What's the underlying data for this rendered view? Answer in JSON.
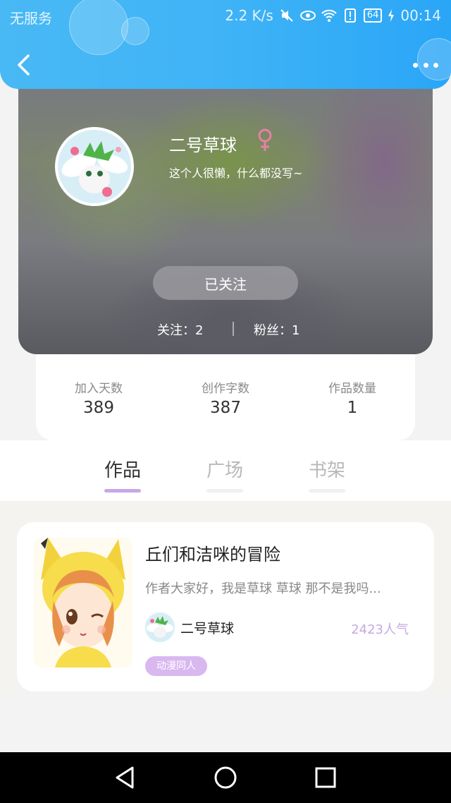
{
  "status_bar": {
    "carrier": "无服务",
    "net_speed": "2.2 K/s",
    "battery": "64",
    "time": "00:14",
    "icons": [
      "mute-icon",
      "eye-icon",
      "wifi-icon",
      "alert-icon",
      "battery-icon",
      "charging-icon"
    ]
  },
  "header": {
    "back_icon": "chevron-left-icon",
    "more_icon": "more-dots-icon"
  },
  "profile": {
    "nickname": "二号草球",
    "gender_symbol": "♀",
    "gender": "female",
    "bio": "这个人很懒，什么都没写~",
    "follow_button": "已关注",
    "following": "关注：2",
    "fans": "粉丝：1"
  },
  "stats": [
    {
      "label": "加入天数",
      "value": "389"
    },
    {
      "label": "创作字数",
      "value": "387"
    },
    {
      "label": "作品数量",
      "value": "1"
    }
  ],
  "tabs": [
    {
      "label": "作品",
      "active": true
    },
    {
      "label": "广场",
      "active": false
    },
    {
      "label": "书架",
      "active": false
    }
  ],
  "works": [
    {
      "title": "丘们和洁咪的冒险",
      "description": "作者大家好，我是草球 草球 那不是我吗...",
      "author": "二号草球",
      "popularity": "2423人气",
      "tag": "动漫同人"
    }
  ],
  "colors": {
    "header": "#3fb3f6",
    "accent_purple": "#c8a8e8",
    "tag_bg": "#d9b8f0",
    "female_pink": "#e67fa6"
  }
}
